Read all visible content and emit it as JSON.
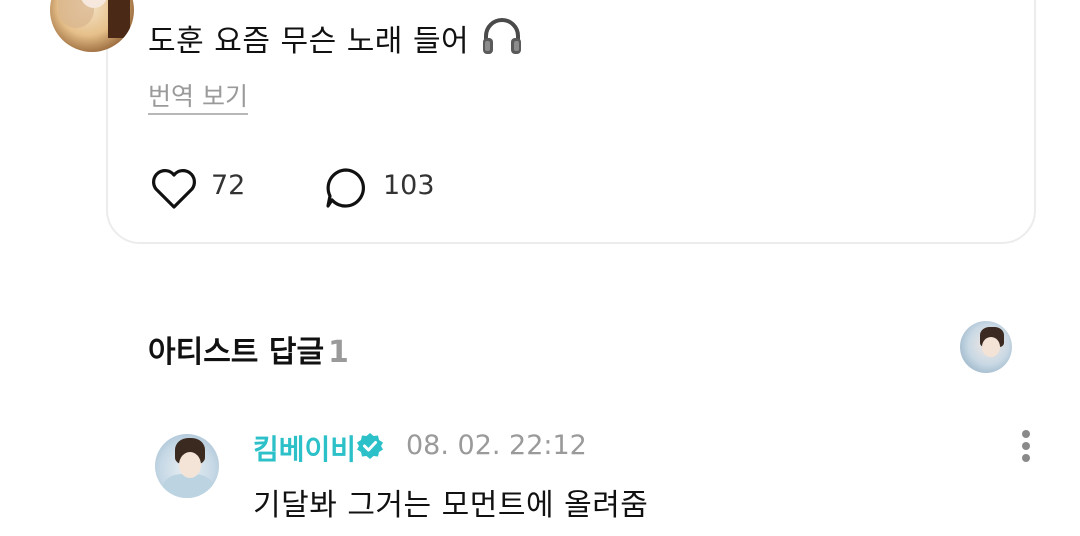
{
  "post": {
    "text": "도훈 요즘 무슨 노래 들어",
    "emoji": "headphones-icon",
    "translate_label": "번역 보기",
    "likes": "72",
    "comments": "103"
  },
  "artist_replies": {
    "title": "아티스트 답글",
    "count": "1"
  },
  "reply": {
    "name": "킴베이비",
    "timestamp": "08. 02. 22:12",
    "text": "기달봐 그거는 모먼트에 올려줌"
  },
  "colors": {
    "accent": "#2cc0c9",
    "muted": "#9a9a9a",
    "card_border": "#ececec"
  }
}
